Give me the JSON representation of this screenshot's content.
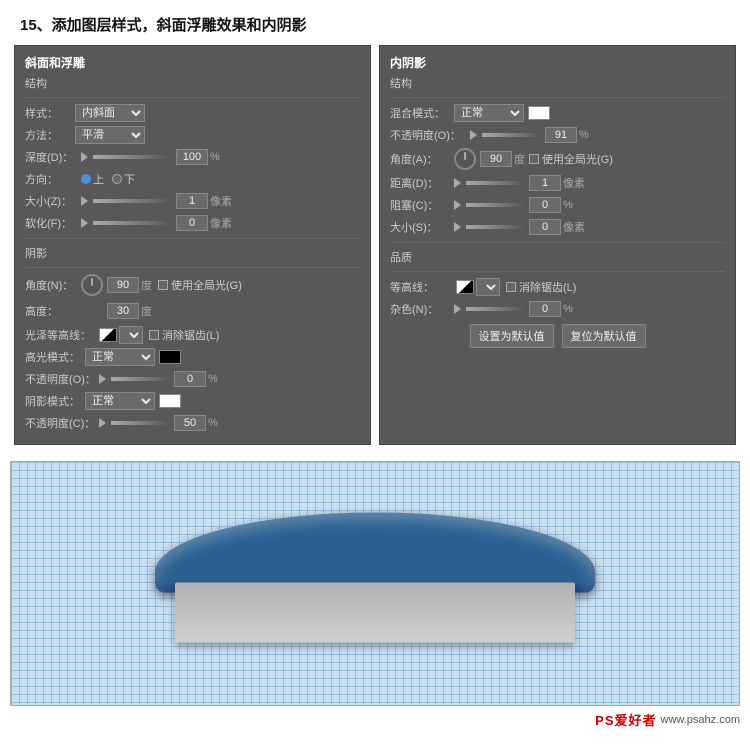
{
  "page": {
    "title": "15、添加图层样式，斜面浮雕效果和内阴影"
  },
  "panel_left": {
    "title": "斜面和浮雕",
    "section1_title": "结构",
    "style_label": "样式：",
    "style_value": "内斜面",
    "method_label": "方法：",
    "method_value": "平滑",
    "depth_label": "深度(D)：",
    "depth_value": "100",
    "depth_unit": "%",
    "direction_label": "方向：",
    "direction_up": "上",
    "direction_down": "下",
    "size_label": "大小(Z)：",
    "size_value": "1",
    "size_unit": "像素",
    "soften_label": "软化(F)：",
    "soften_value": "0",
    "soften_unit": "像素",
    "section2_title": "阴影",
    "angle_label": "角度(N)：",
    "angle_value": "90",
    "angle_unit": "度",
    "global_light": "使用全局光(G)",
    "altitude_label": "高度：",
    "altitude_value": "30",
    "altitude_unit": "度",
    "gloss_label": "光泽等高线：",
    "elim_alias": "消除锯齿(L)",
    "highlight_mode_label": "高光模式：",
    "highlight_mode_value": "正常",
    "highlight_opacity_label": "不透明度(O)：",
    "highlight_opacity_value": "0",
    "highlight_opacity_unit": "%",
    "shadow_mode_label": "阴影模式：",
    "shadow_mode_value": "正常",
    "shadow_opacity_label": "不透明度(C)：",
    "shadow_opacity_value": "50",
    "shadow_opacity_unit": "%"
  },
  "panel_right": {
    "title": "内阴影",
    "section1_title": "结构",
    "blend_mode_label": "混合模式：",
    "blend_mode_value": "正常",
    "opacity_label": "不透明度(O)：",
    "opacity_value": "91",
    "opacity_unit": "%",
    "angle_label": "角度(A)：",
    "angle_value": "90",
    "angle_unit": "度",
    "global_light": "使用全局光(G)",
    "distance_label": "距离(D)：",
    "distance_value": "1",
    "distance_unit": "像素",
    "choke_label": "阻塞(C)：",
    "choke_value": "0",
    "choke_unit": "%",
    "size_label": "大小(S)：",
    "size_value": "0",
    "size_unit": "像素",
    "section2_title": "品质",
    "contour_label": "等高线：",
    "elim_alias": "消除锯齿(L)",
    "noise_label": "杂色(N)：",
    "noise_value": "0",
    "noise_unit": "%",
    "btn_default": "设置为默认值",
    "btn_reset": "复位为默认值"
  },
  "footer": {
    "logo": "PS爱好者",
    "site": "www.psahz.com"
  }
}
